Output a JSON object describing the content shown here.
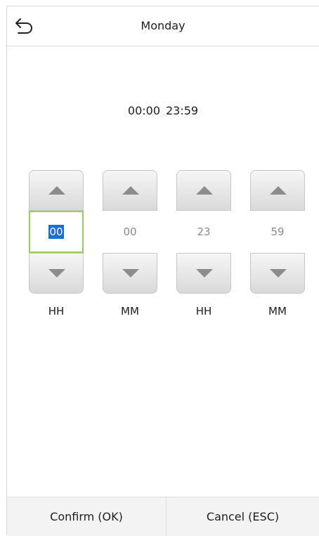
{
  "header": {
    "title": "Monday",
    "back_icon": "back-arrow-icon"
  },
  "time_range": {
    "start": "00:00",
    "end": "23:59"
  },
  "spinners": [
    {
      "value": "00",
      "label": "HH",
      "active": true
    },
    {
      "value": "00",
      "label": "MM",
      "active": false
    },
    {
      "value": "23",
      "label": "HH",
      "active": false
    },
    {
      "value": "59",
      "label": "MM",
      "active": false
    }
  ],
  "icons": {
    "up": "triangle-up-icon",
    "down": "triangle-down-icon"
  },
  "colors": {
    "active_border": "#92d15a",
    "selection": "#1a6fd0",
    "arrow": "#8c8c8c"
  },
  "footer": {
    "confirm_label": "Confirm (OK)",
    "cancel_label": "Cancel (ESC)"
  }
}
